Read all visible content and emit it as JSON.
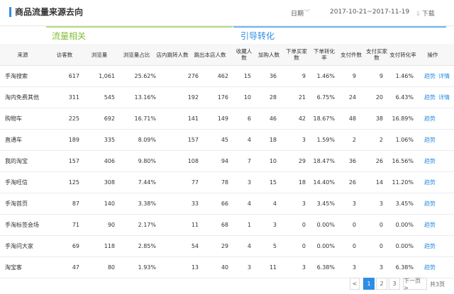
{
  "header": {
    "title": "商品流量来源去向",
    "date_label": "日期",
    "date_range": "2017-10-21~2017-11-19",
    "download_label": "下载",
    "accent_color": "#2e8de6"
  },
  "groups": {
    "traffic": "流量相关",
    "conversion": "引导转化"
  },
  "columns": [
    "来源",
    "访客数",
    "浏览量",
    "浏览量占比",
    "店内跳转人数",
    "跳出本店人数",
    "收藏人数",
    "加购人数",
    "下单买家数",
    "下单转化率",
    "支付件数",
    "支付买家数",
    "支付转化率",
    "操作"
  ],
  "rows": [
    {
      "source": "手淘搜索",
      "visitors": "617",
      "pageviews": "1,061",
      "pv_share": "25.62%",
      "inshop_jump": "276",
      "exit_shop": "462",
      "favorites": "15",
      "add_cart": "36",
      "order_buyers": "9",
      "order_rate": "1.46%",
      "pay_items": "9",
      "pay_buyers": "9",
      "pay_rate": "1.46%",
      "ops": [
        "趋势",
        "详情"
      ]
    },
    {
      "source": "淘内免费其他",
      "visitors": "311",
      "pageviews": "545",
      "pv_share": "13.16%",
      "inshop_jump": "192",
      "exit_shop": "176",
      "favorites": "10",
      "add_cart": "28",
      "order_buyers": "21",
      "order_rate": "6.75%",
      "pay_items": "24",
      "pay_buyers": "20",
      "pay_rate": "6.43%",
      "ops": [
        "趋势",
        "详情"
      ]
    },
    {
      "source": "购物车",
      "visitors": "225",
      "pageviews": "692",
      "pv_share": "16.71%",
      "inshop_jump": "141",
      "exit_shop": "149",
      "favorites": "6",
      "add_cart": "46",
      "order_buyers": "42",
      "order_rate": "18.67%",
      "pay_items": "48",
      "pay_buyers": "38",
      "pay_rate": "16.89%",
      "ops": [
        "趋势"
      ]
    },
    {
      "source": "直通车",
      "visitors": "189",
      "pageviews": "335",
      "pv_share": "8.09%",
      "inshop_jump": "157",
      "exit_shop": "45",
      "favorites": "4",
      "add_cart": "18",
      "order_buyers": "3",
      "order_rate": "1.59%",
      "pay_items": "2",
      "pay_buyers": "2",
      "pay_rate": "1.06%",
      "ops": [
        "趋势"
      ]
    },
    {
      "source": "我的淘宝",
      "visitors": "157",
      "pageviews": "406",
      "pv_share": "9.80%",
      "inshop_jump": "108",
      "exit_shop": "94",
      "favorites": "7",
      "add_cart": "10",
      "order_buyers": "29",
      "order_rate": "18.47%",
      "pay_items": "36",
      "pay_buyers": "26",
      "pay_rate": "16.56%",
      "ops": [
        "趋势"
      ]
    },
    {
      "source": "手淘旺信",
      "visitors": "125",
      "pageviews": "308",
      "pv_share": "7.44%",
      "inshop_jump": "77",
      "exit_shop": "78",
      "favorites": "3",
      "add_cart": "15",
      "order_buyers": "18",
      "order_rate": "14.40%",
      "pay_items": "26",
      "pay_buyers": "14",
      "pay_rate": "11.20%",
      "ops": [
        "趋势"
      ]
    },
    {
      "source": "手淘首页",
      "visitors": "87",
      "pageviews": "140",
      "pv_share": "3.38%",
      "inshop_jump": "33",
      "exit_shop": "66",
      "favorites": "4",
      "add_cart": "4",
      "order_buyers": "3",
      "order_rate": "3.45%",
      "pay_items": "3",
      "pay_buyers": "3",
      "pay_rate": "3.45%",
      "ops": [
        "趋势"
      ]
    },
    {
      "source": "手淘标签会场",
      "visitors": "71",
      "pageviews": "90",
      "pv_share": "2.17%",
      "inshop_jump": "11",
      "exit_shop": "68",
      "favorites": "1",
      "add_cart": "3",
      "order_buyers": "0",
      "order_rate": "0.00%",
      "pay_items": "0",
      "pay_buyers": "0",
      "pay_rate": "0.00%",
      "ops": [
        "趋势"
      ]
    },
    {
      "source": "手淘问大家",
      "visitors": "69",
      "pageviews": "118",
      "pv_share": "2.85%",
      "inshop_jump": "54",
      "exit_shop": "29",
      "favorites": "4",
      "add_cart": "5",
      "order_buyers": "0",
      "order_rate": "0.00%",
      "pay_items": "0",
      "pay_buyers": "0",
      "pay_rate": "0.00%",
      "ops": [
        "趋势"
      ]
    },
    {
      "source": "淘宝客",
      "visitors": "47",
      "pageviews": "80",
      "pv_share": "1.93%",
      "inshop_jump": "13",
      "exit_shop": "40",
      "favorites": "3",
      "add_cart": "11",
      "order_buyers": "3",
      "order_rate": "6.38%",
      "pay_items": "3",
      "pay_buyers": "3",
      "pay_rate": "6.38%",
      "ops": [
        "趋势"
      ]
    }
  ],
  "pagination": {
    "prev": "<",
    "pages": [
      "1",
      "2",
      "3"
    ],
    "current": "1",
    "next": "下一页 >",
    "total": "共3页"
  }
}
